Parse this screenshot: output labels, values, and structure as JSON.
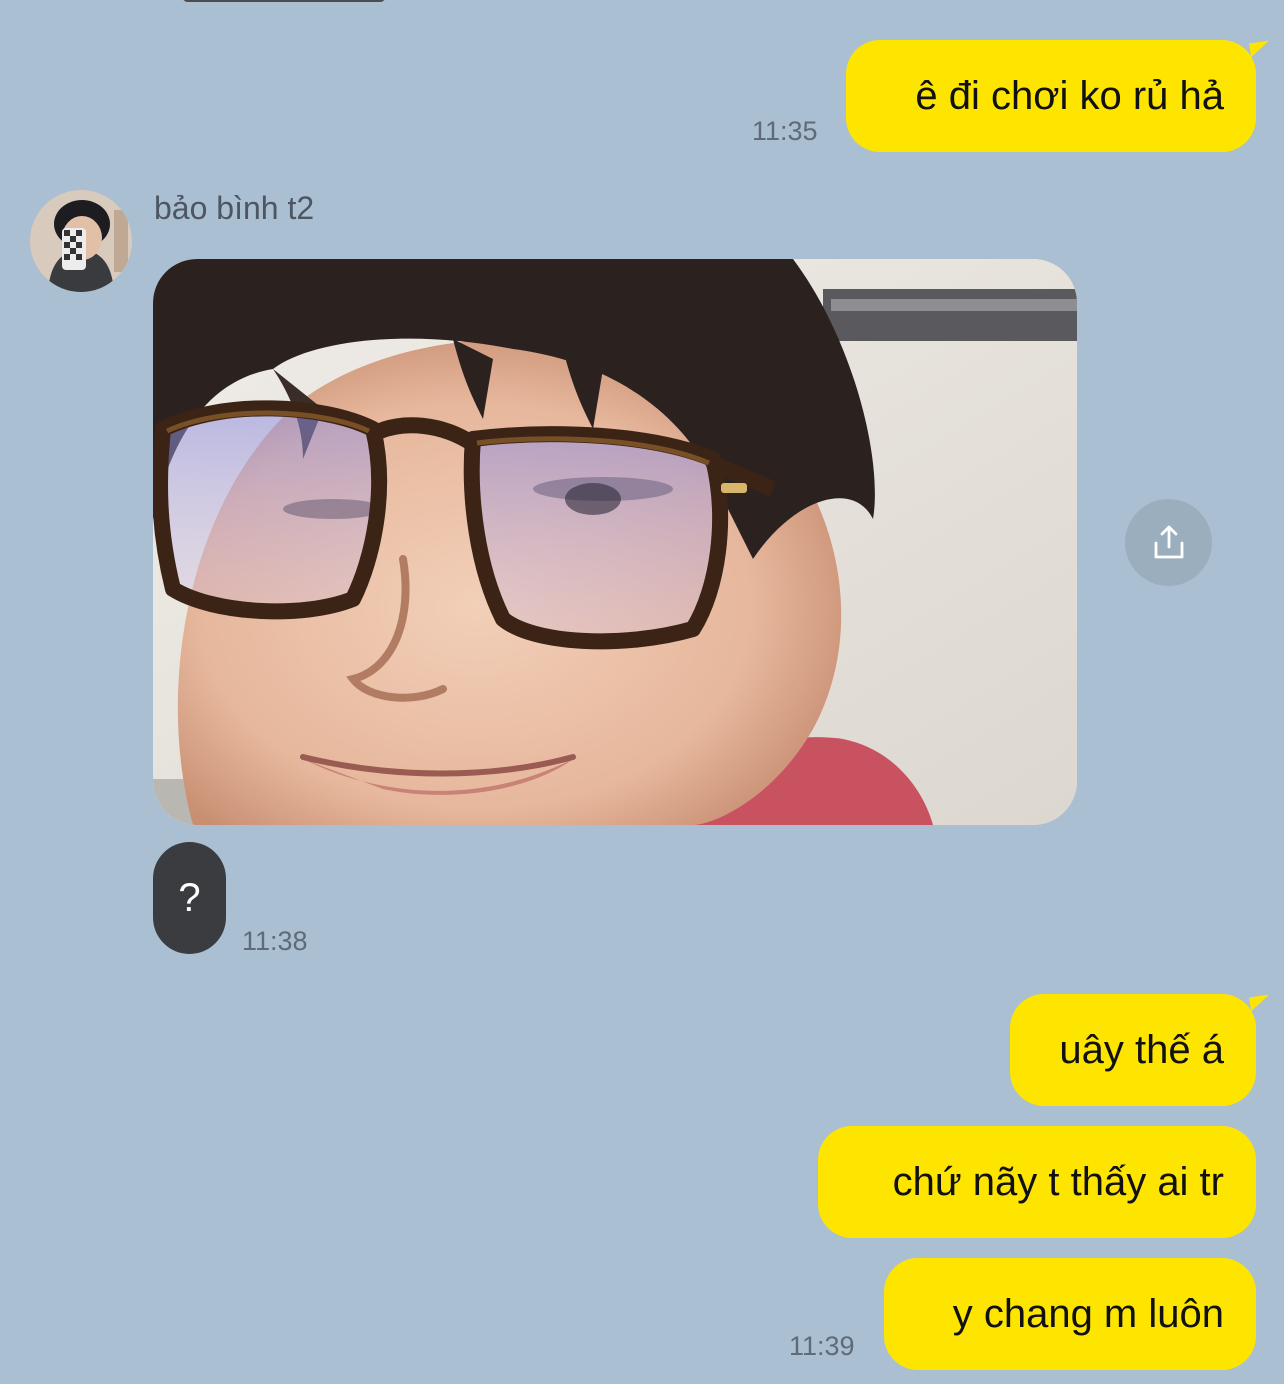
{
  "messages": {
    "m1": {
      "text": "ê đi chơi ko rủ hả",
      "time": "11:35"
    },
    "incoming": {
      "sender": "bảo bình t2",
      "text": "?",
      "time": "11:38"
    },
    "m2": {
      "text": "uây thế á"
    },
    "m3": {
      "text": "chứ nãy t thấy ai tr"
    },
    "m4": {
      "text": "y chang m luôn",
      "time": "11:39"
    }
  },
  "icons": {
    "share": "share-icon",
    "avatar": "avatar"
  },
  "colors": {
    "background": "#aabfd2",
    "outgoing_bubble": "#fee500",
    "incoming_bubble": "#3b3c3f"
  }
}
